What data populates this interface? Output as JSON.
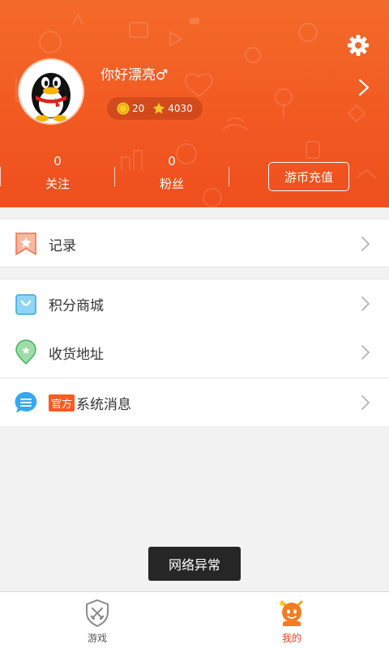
{
  "profile": {
    "username": "你好漂亮♂",
    "coins": "20",
    "stars": "4030"
  },
  "stats": [
    {
      "value": "0",
      "label": "关注"
    },
    {
      "value": "0",
      "label": "粉丝"
    }
  ],
  "recharge_label": "游币充值",
  "menu": {
    "records": "记录",
    "points_mall": "积分商城",
    "shipping_address": "收货地址",
    "official_tag": "官方",
    "system_messages": "系统消息"
  },
  "toast": "网络异常",
  "tabs": [
    {
      "label": "游戏",
      "active": false
    },
    {
      "label": "我的",
      "active": true
    }
  ],
  "colors": {
    "header": "#f25a22",
    "accent": "#ff5a1f",
    "active_tab": "#e8411b",
    "inactive_tab": "#555555"
  }
}
